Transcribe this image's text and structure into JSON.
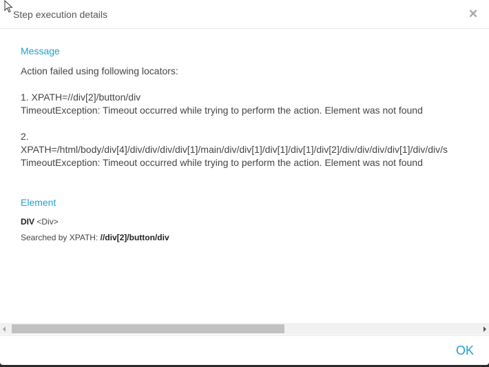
{
  "dialog": {
    "title": "Step execution details",
    "close_glyph": "×",
    "ok_label": "OK"
  },
  "message": {
    "heading": "Message",
    "lines": [
      "Action failed using following locators:",
      "1. XPATH=//div[2]/button/div",
      "TimeoutException: Timeout occurred while trying to perform the action. Element was not found",
      "2.",
      "XPATH=/html/body/div[4]/div/div/div/div[1]/main/div/div[1]/div[1]/div[1]/div[2]/div/div/div/div[1]/div/div/s",
      "TimeoutException: Timeout occurred while trying to perform the action. Element was not found"
    ]
  },
  "element": {
    "heading": "Element",
    "tag": "DIV",
    "tag_detail": "<Div>",
    "searched_by_label": "Searched by XPATH:",
    "searched_by_value": "//div[2]/button/div"
  },
  "icons": {
    "close": "close-icon",
    "cursor": "mouse-pointer-icon"
  },
  "colors": {
    "accent": "#1da1d1",
    "text": "#444444",
    "close": "#a9a9a9"
  }
}
